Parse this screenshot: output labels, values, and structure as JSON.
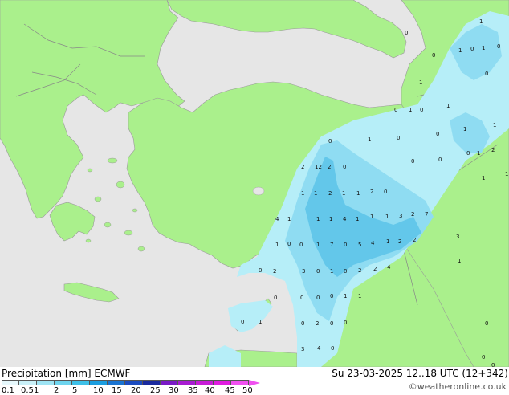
{
  "footer": {
    "title": "Precipitation [mm]  ECMWF",
    "timestamp": "Su 23-03-2025 12..18 UTC (12+342)",
    "credit": "©weatheronline.co.uk"
  },
  "legend": {
    "ticks": [
      "0.1",
      "0.5",
      "1",
      "2",
      "5",
      "10",
      "15",
      "20",
      "25",
      "30",
      "35",
      "40",
      "45",
      "50"
    ],
    "colors": [
      "#e6f8fc",
      "#c8f0f8",
      "#9ee4f4",
      "#6ed4ee",
      "#3ec0e8",
      "#1c9ee0",
      "#1a74d2",
      "#1c4cc0",
      "#1a2a9e",
      "#7a1ac6",
      "#a81cd2",
      "#c81cd8",
      "#e01ce0",
      "#f050f0"
    ]
  },
  "colors": {
    "sea": "#e6e6e6",
    "land": "#aaf08c",
    "coast": "#999999",
    "precip_light": "#b6eef8",
    "precip_mid": "#8fdcf2",
    "precip_heavy": "#63c7ea"
  },
  "map_values": [
    {
      "v": "1"
    },
    {
      "v": "0"
    },
    {
      "v": "1"
    },
    {
      "v": "0"
    },
    {
      "v": "1"
    },
    {
      "v": "0"
    },
    {
      "v": "0"
    },
    {
      "v": "0"
    },
    {
      "v": "1"
    },
    {
      "v": "0"
    },
    {
      "v": "1"
    },
    {
      "v": "0"
    },
    {
      "v": "1"
    },
    {
      "v": "1"
    },
    {
      "v": "1"
    },
    {
      "v": "0"
    },
    {
      "v": "1"
    },
    {
      "v": "0"
    },
    {
      "v": "0"
    },
    {
      "v": "0"
    },
    {
      "v": "1"
    },
    {
      "v": "2"
    },
    {
      "v": "0"
    },
    {
      "v": "0"
    },
    {
      "v": "1"
    },
    {
      "v": "2"
    },
    {
      "v": "12"
    },
    {
      "v": "2"
    },
    {
      "v": "0"
    },
    {
      "v": "1"
    },
    {
      "v": "1"
    },
    {
      "v": "1"
    },
    {
      "v": "2"
    },
    {
      "v": "1"
    },
    {
      "v": "1"
    },
    {
      "v": "2"
    },
    {
      "v": "0"
    },
    {
      "v": "4"
    },
    {
      "v": "1"
    },
    {
      "v": "1"
    },
    {
      "v": "1"
    },
    {
      "v": "4"
    },
    {
      "v": "1"
    },
    {
      "v": "1"
    },
    {
      "v": "1"
    },
    {
      "v": "3"
    },
    {
      "v": "2"
    },
    {
      "v": "7"
    },
    {
      "v": "3"
    },
    {
      "v": "1"
    },
    {
      "v": "0"
    },
    {
      "v": "0"
    },
    {
      "v": "1"
    },
    {
      "v": "7"
    },
    {
      "v": "0"
    },
    {
      "v": "5"
    },
    {
      "v": "4"
    },
    {
      "v": "1"
    },
    {
      "v": "2"
    },
    {
      "v": "2"
    },
    {
      "v": "0"
    },
    {
      "v": "2"
    },
    {
      "v": "3"
    },
    {
      "v": "0"
    },
    {
      "v": "1"
    },
    {
      "v": "0"
    },
    {
      "v": "2"
    },
    {
      "v": "2"
    },
    {
      "v": "4"
    },
    {
      "v": "1"
    },
    {
      "v": "0"
    },
    {
      "v": "0"
    },
    {
      "v": "0"
    },
    {
      "v": "1"
    },
    {
      "v": "1"
    },
    {
      "v": "0"
    },
    {
      "v": "0"
    },
    {
      "v": "2"
    },
    {
      "v": "0"
    },
    {
      "v": "0"
    },
    {
      "v": "0"
    },
    {
      "v": "1"
    },
    {
      "v": "0"
    },
    {
      "v": "0"
    },
    {
      "v": "3"
    },
    {
      "v": "4"
    },
    {
      "v": "0"
    },
    {
      "v": "0"
    }
  ]
}
